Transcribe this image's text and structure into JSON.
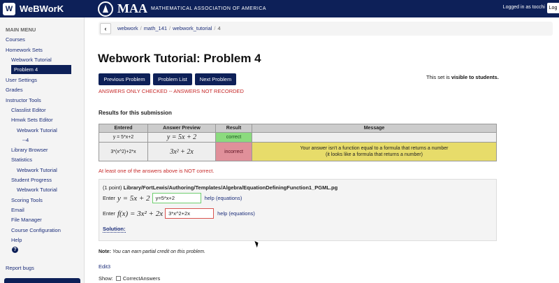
{
  "header": {
    "app_name": "WeBWorK",
    "maa_name": "MAA",
    "maa_full": "MATHEMATICAL ASSOCIATION OF AMERICA",
    "logged_in": "Logged in as tocchi",
    "log_button": "Log"
  },
  "sidebar": {
    "main_menu": "MAIN MENU",
    "items": [
      "Courses",
      "Homework Sets",
      "Webwork Tutorial",
      "Problem 4",
      "User Settings",
      "Grades",
      "Instructor Tools",
      "Classlist Editor",
      "Hmwk Sets Editor",
      "Webwork Tutorial",
      "--4",
      "Library Browser",
      "Statistics",
      "Webwork Tutorial",
      "Student Progress",
      "Webwork Tutorial",
      "Scoring Tools",
      "Email",
      "File Manager",
      "Course Configuration",
      "Help",
      "Report bugs"
    ],
    "help_icon": "question-circle-icon"
  },
  "breadcrumb": {
    "back_icon": "chevron-left-icon",
    "items": [
      "webwork",
      "math_141",
      "webwork_tutorial",
      "4"
    ],
    "separator": "/"
  },
  "page": {
    "title": "Webwork Tutorial: Problem 4",
    "prev_button": "Previous Problem",
    "list_button": "Problem List",
    "next_button": "Next Problem",
    "visible_prefix": "This set is ",
    "visible_bold": "visible to students.",
    "not_recorded": "ANSWERS ONLY CHECKED -- ANSWERS NOT RECORDED",
    "results_heading": "Results for this submission",
    "at_least_one": "At least one of the answers above is NOT correct."
  },
  "results_table": {
    "headers": [
      "Entered",
      "Answer Preview",
      "Result",
      "Message"
    ],
    "rows": [
      {
        "entered": "y = 5*x+2",
        "preview": "y = 5x + 2",
        "result": "correct",
        "message": ""
      },
      {
        "entered": "3*(x^2)+2*x",
        "preview": "3x² + 2x",
        "result": "incorrect",
        "message_line1": "Your answer isn't a function equal to a formula that returns a number",
        "message_line2": "(it looks like a formula that returns a number)"
      }
    ],
    "colors": {
      "correct": "#8bdb7e",
      "incorrect": "#e0909a",
      "message": "#e7dc6a"
    }
  },
  "problem": {
    "points": "(1 point)",
    "path": "Library/FortLewis/Authoring/Templates/Algebra/EquationDefiningFunction1_PGML.pg",
    "enter1_prefix": "Enter",
    "enter1_math": "y = 5x + 2",
    "answer1": "y=5*x+2",
    "enter2_prefix": "Enter",
    "enter2_math": "f(x) = 3x² + 2x",
    "answer2": "3*x^2+2x",
    "help_link": "help (equations)",
    "solution": "Solution:"
  },
  "footer": {
    "note_bold": "Note:",
    "note_text": "You can earn partial credit on this problem.",
    "edit3": "Edit3",
    "show_label": "Show:",
    "correct_answers": "CorrectAnswers"
  }
}
